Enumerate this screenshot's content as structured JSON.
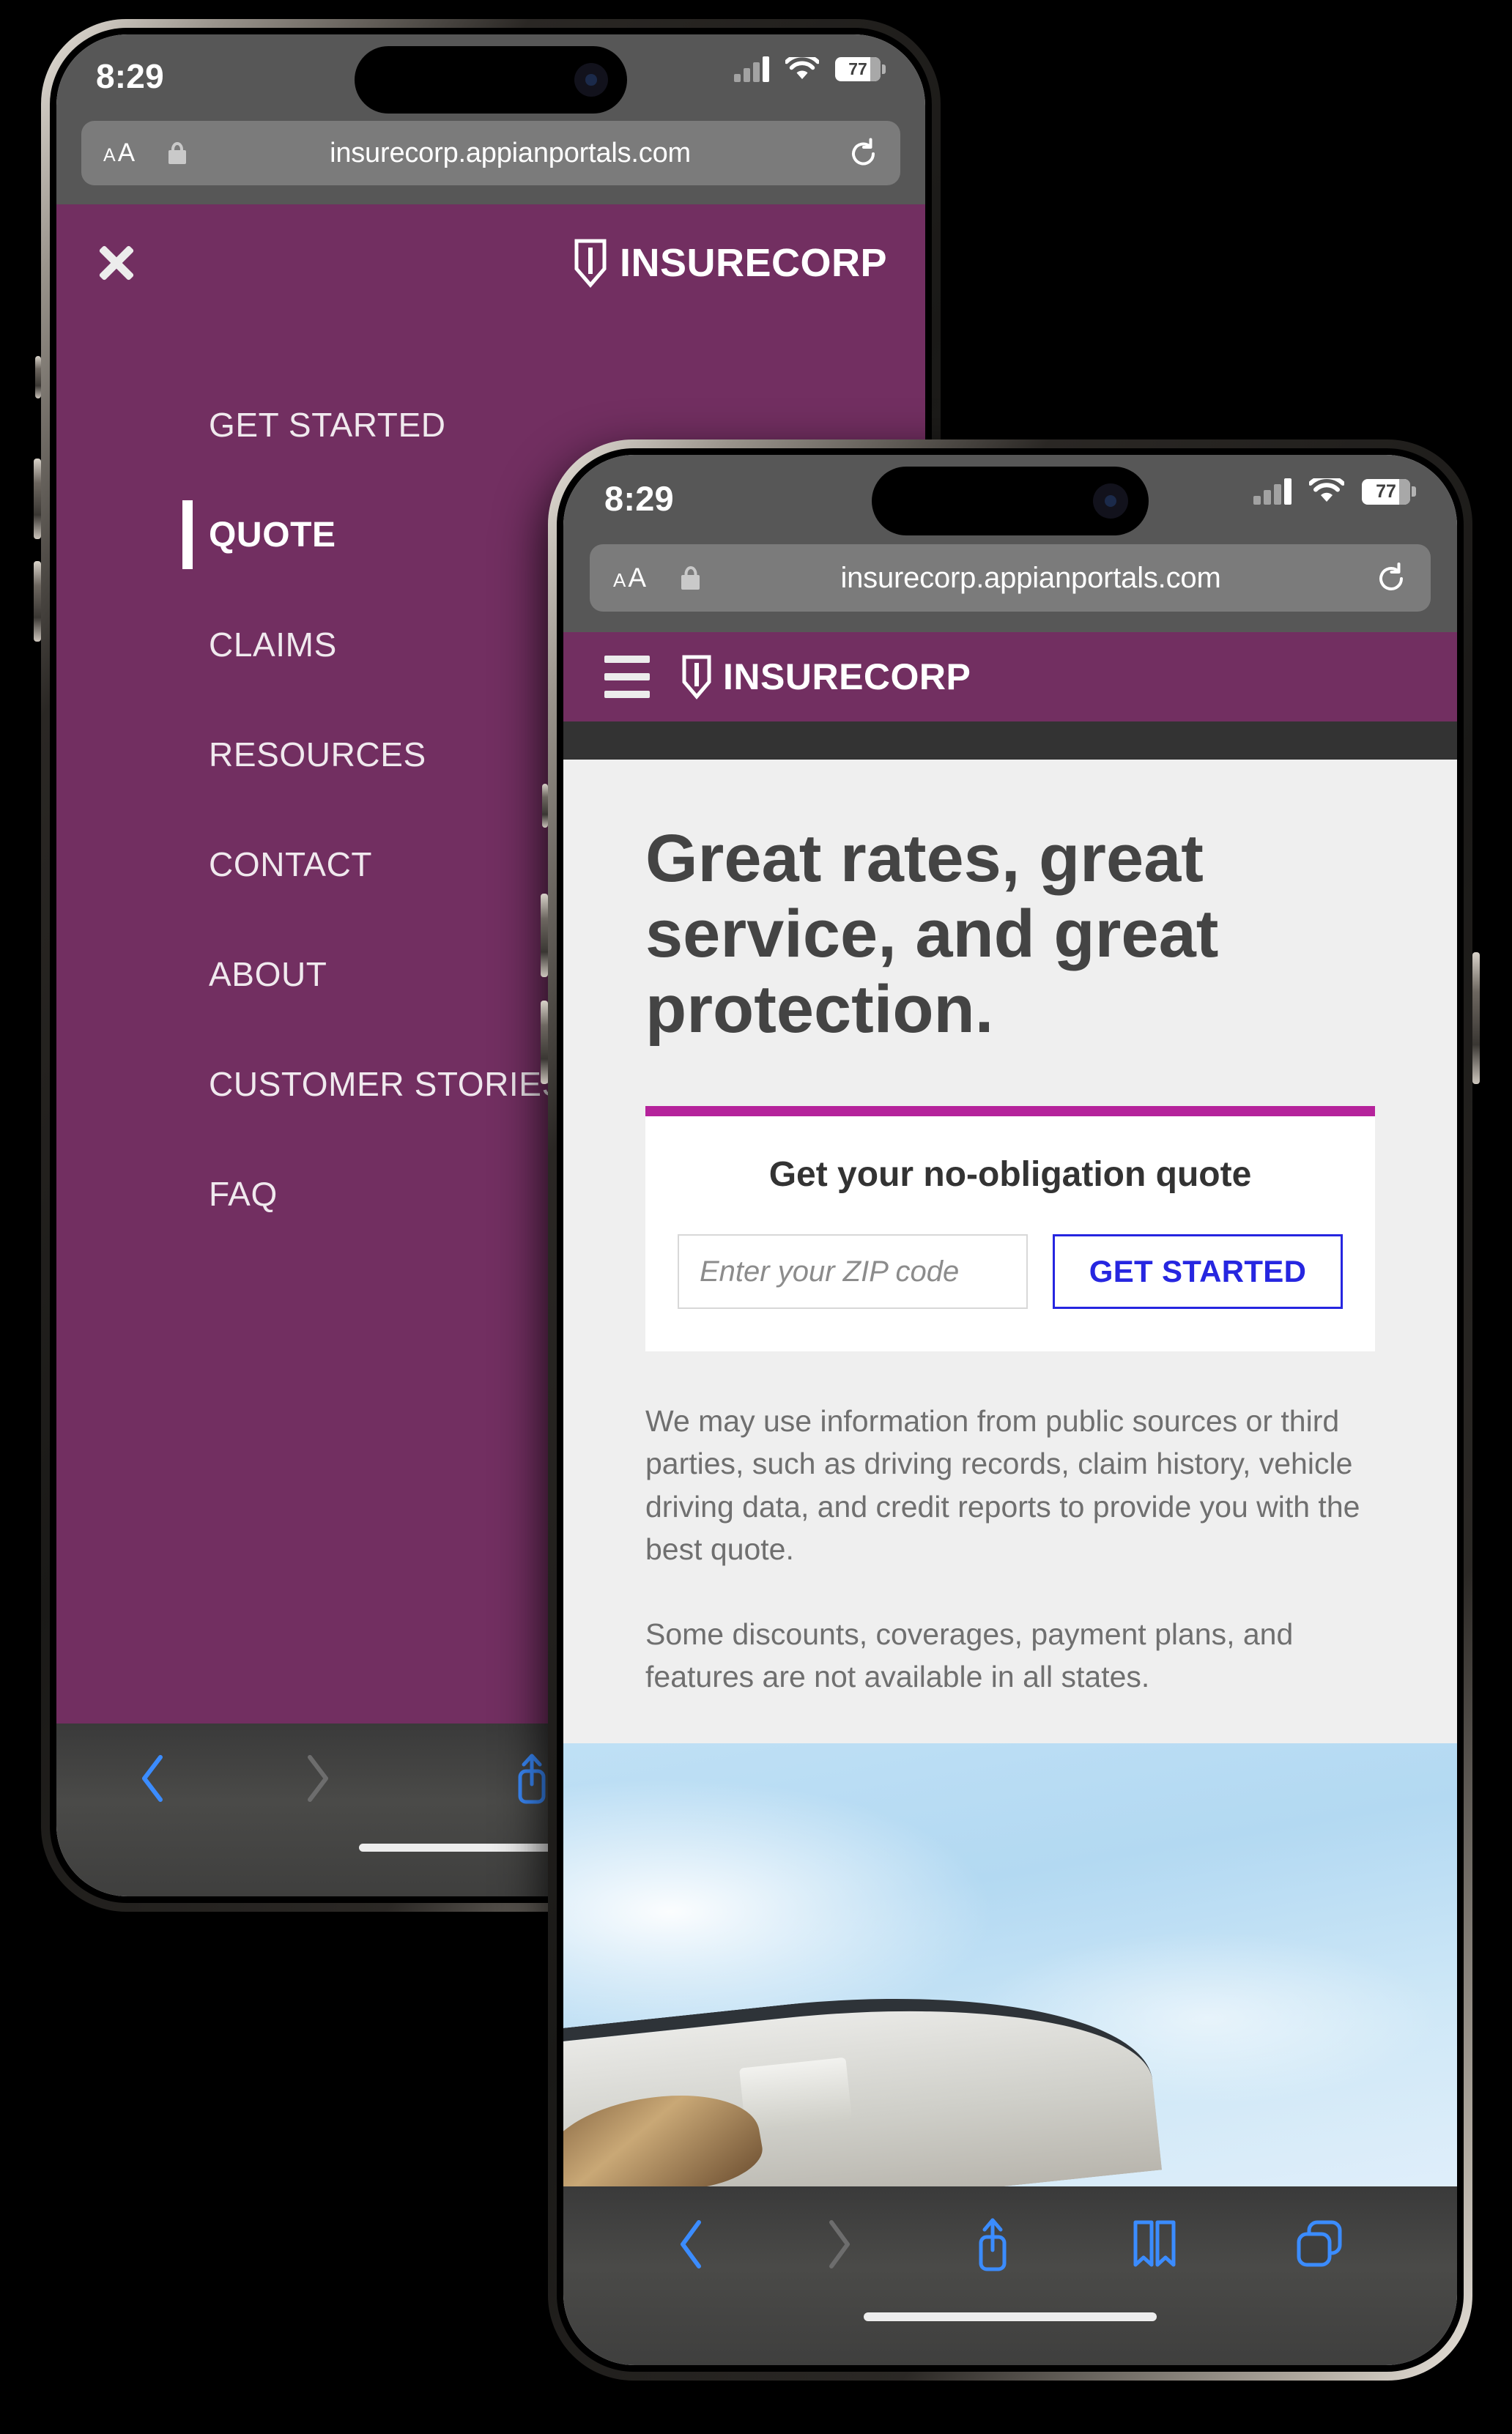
{
  "theme": {
    "brand_purple": "#722F61",
    "accent_magenta": "#b5239b",
    "cta_blue": "#2626e0",
    "safari_chrome": "#575757",
    "page_bg": "#efefef"
  },
  "back_phone": {
    "status_bar": {
      "time": "8:29",
      "signal_icon": "cellular-bars-icon",
      "wifi_icon": "wifi-icon",
      "battery_icon": "battery-icon",
      "battery_level": "77"
    },
    "url_bar": {
      "text_size_label": "AA",
      "lock_icon": "lock-icon",
      "url": "insurecorp.appianportals.com",
      "reload_icon": "reload-icon"
    },
    "site_header": {
      "close_icon": "close-x-icon",
      "shield_icon": "shield-icon",
      "brand": "INSURECORP"
    },
    "nav": {
      "items": [
        {
          "label": "GET STARTED",
          "active": false
        },
        {
          "label": "QUOTE",
          "active": true
        },
        {
          "label": "CLAIMS",
          "active": false
        },
        {
          "label": "RESOURCES",
          "active": false
        },
        {
          "label": "CONTACT",
          "active": false
        },
        {
          "label": "ABOUT",
          "active": false
        },
        {
          "label": "CUSTOMER STORIES",
          "active": false
        },
        {
          "label": "FAQ",
          "active": false
        }
      ]
    },
    "toolbar": {
      "back_icon": "chevron-left-icon",
      "forward_icon": "chevron-right-icon",
      "share_icon": "share-icon"
    }
  },
  "front_phone": {
    "status_bar": {
      "time": "8:29",
      "signal_icon": "cellular-bars-icon",
      "wifi_icon": "wifi-icon",
      "battery_icon": "battery-icon",
      "battery_level": "77"
    },
    "url_bar": {
      "text_size_label": "AA",
      "lock_icon": "lock-icon",
      "url": "insurecorp.appianportals.com",
      "reload_icon": "reload-icon"
    },
    "site_header": {
      "menu_icon": "hamburger-menu-icon",
      "shield_icon": "shield-icon",
      "brand": "INSURECORP"
    },
    "content": {
      "headline": "Great rates, great service, and great protection.",
      "quote_card": {
        "title": "Get your no-obligation quote",
        "zip_placeholder": "Enter your ZIP code",
        "zip_value": "",
        "cta_label": "GET STARTED"
      },
      "disclaimer_1": "We may use information from public sources or third parties, such as driving records, claim history, vehicle driving data, and credit reports to provide you with the best quote.",
      "disclaimer_2": "Some discounts, coverages, payment plans, and features are not available in all states.",
      "hero_image_alt": "woman-in-convertible-car-photo"
    },
    "toolbar": {
      "back_icon": "chevron-left-icon",
      "forward_icon": "chevron-right-icon",
      "share_icon": "share-icon",
      "bookmarks_icon": "book-icon",
      "tabs_icon": "tabs-icon"
    }
  }
}
